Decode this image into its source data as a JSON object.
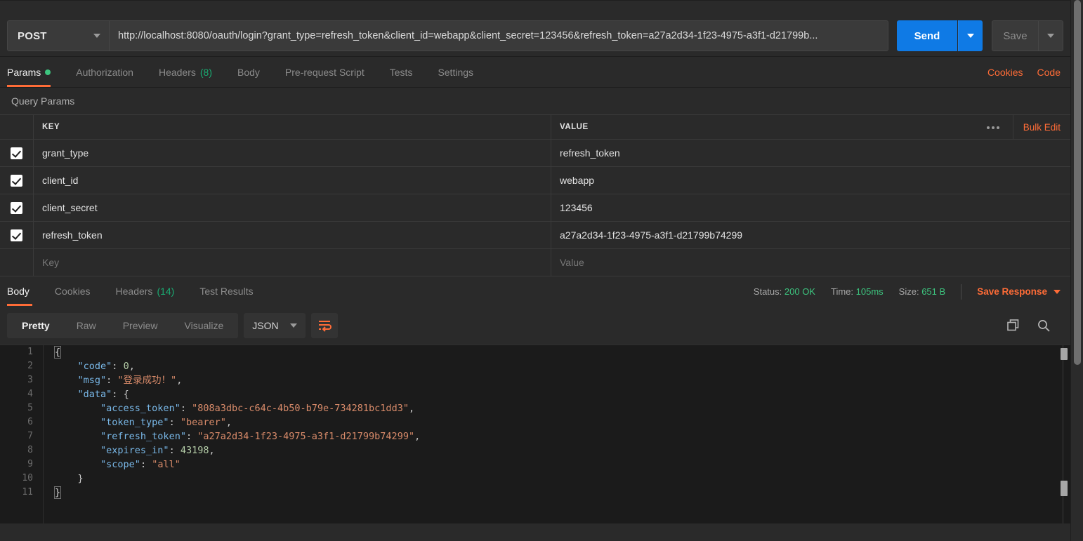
{
  "request": {
    "method": "POST",
    "url": "http://localhost:8080/oauth/login?grant_type=refresh_token&client_id=webapp&client_secret=123456&refresh_token=a27a2d34-1f23-4975-a3f1-d21799b...",
    "send_label": "Send",
    "save_label": "Save",
    "tabs": [
      {
        "label": "Params",
        "badge": "",
        "dot": true,
        "active": true
      },
      {
        "label": "Authorization",
        "badge": "",
        "dot": false,
        "active": false
      },
      {
        "label": "Headers",
        "badge": "(8)",
        "dot": false,
        "active": false
      },
      {
        "label": "Body",
        "badge": "",
        "dot": false,
        "active": false
      },
      {
        "label": "Pre-request Script",
        "badge": "",
        "dot": false,
        "active": false
      },
      {
        "label": "Tests",
        "badge": "",
        "dot": false,
        "active": false
      },
      {
        "label": "Settings",
        "badge": "",
        "dot": false,
        "active": false
      }
    ],
    "cookies_link": "Cookies",
    "code_link": "Code"
  },
  "query_params": {
    "section_title": "Query Params",
    "col_key": "KEY",
    "col_value": "VALUE",
    "bulk_edit": "Bulk Edit",
    "rows": [
      {
        "checked": true,
        "key": "grant_type",
        "value": "refresh_token"
      },
      {
        "checked": true,
        "key": "client_id",
        "value": "webapp"
      },
      {
        "checked": true,
        "key": "client_secret",
        "value": "123456"
      },
      {
        "checked": true,
        "key": "refresh_token",
        "value": "a27a2d34-1f23-4975-a3f1-d21799b74299"
      }
    ],
    "empty_row": {
      "key_placeholder": "Key",
      "value_placeholder": "Value"
    }
  },
  "response": {
    "tabs": [
      {
        "label": "Body",
        "badge": "",
        "active": true
      },
      {
        "label": "Cookies",
        "badge": "",
        "active": false
      },
      {
        "label": "Headers",
        "badge": "(14)",
        "active": false
      },
      {
        "label": "Test Results",
        "badge": "",
        "active": false
      }
    ],
    "meta": {
      "status_label": "Status:",
      "status_value": "200 OK",
      "time_label": "Time:",
      "time_value": "105ms",
      "size_label": "Size:",
      "size_value": "651 B"
    },
    "save_response": "Save Response",
    "format_tabs": [
      {
        "label": "Pretty",
        "active": true
      },
      {
        "label": "Raw",
        "active": false
      },
      {
        "label": "Preview",
        "active": false
      },
      {
        "label": "Visualize",
        "active": false
      }
    ],
    "language": "JSON",
    "body_lines": [
      "1",
      "2",
      "3",
      "4",
      "5",
      "6",
      "7",
      "8",
      "9",
      "10",
      "11"
    ],
    "body_json": {
      "code": 0,
      "msg": "登录成功！",
      "data": {
        "access_token": "808a3dbc-c64c-4b50-b79e-734281bc1dd3",
        "token_type": "bearer",
        "refresh_token": "a27a2d34-1f23-4975-a3f1-d21799b74299",
        "expires_in": 43198,
        "scope": "all"
      }
    }
  },
  "colors": {
    "accent": "#ff6c37",
    "send": "#0f7ae5",
    "success": "#3dc57f",
    "background": "#2a2a2a",
    "code_background": "#1b1b1b"
  }
}
